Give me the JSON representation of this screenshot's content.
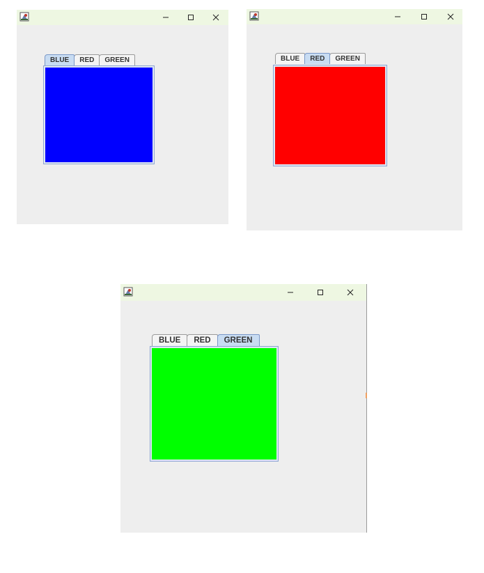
{
  "windows": [
    {
      "id": "blue",
      "tabs": [
        {
          "label": "BLUE",
          "selected": true
        },
        {
          "label": "RED",
          "selected": false
        },
        {
          "label": "GREEN",
          "selected": false
        }
      ],
      "panel_color": "#0000ff"
    },
    {
      "id": "red",
      "tabs": [
        {
          "label": "BLUE",
          "selected": false
        },
        {
          "label": "RED",
          "selected": true
        },
        {
          "label": "GREEN",
          "selected": false
        }
      ],
      "panel_color": "#ff0000"
    },
    {
      "id": "green",
      "tabs": [
        {
          "label": "BLUE",
          "selected": false
        },
        {
          "label": "RED",
          "selected": false
        },
        {
          "label": "GREEN",
          "selected": true
        }
      ],
      "panel_color": "#00ff00"
    }
  ],
  "icons": {
    "app": "java-app-icon",
    "minimize": "minimize-icon",
    "maximize": "maximize-icon",
    "close": "close-icon"
  },
  "colors": {
    "titlebar_bg": "#eef7e2",
    "window_bg": "#eeeeee",
    "selected_tab_bg": "#c8dcf2",
    "panel_border": "#8ea6d3"
  }
}
